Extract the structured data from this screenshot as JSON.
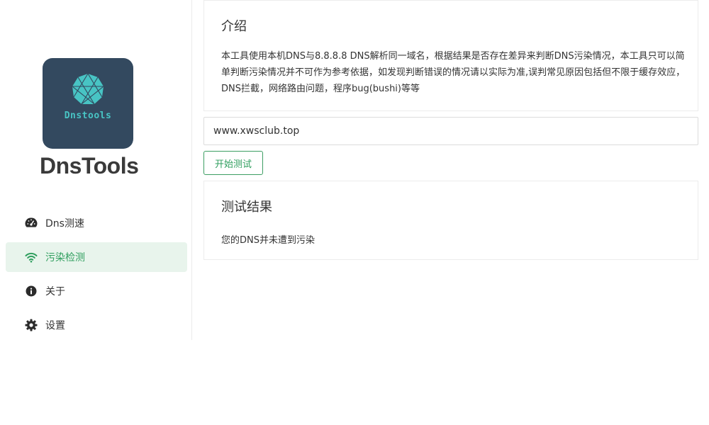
{
  "sidebar": {
    "logo_text": "Dnstools",
    "app_title": "DnsTools",
    "items": [
      {
        "label": "Dns测速",
        "icon": "speedometer-icon"
      },
      {
        "label": "污染检测",
        "icon": "wifi-icon",
        "active": true
      },
      {
        "label": "关于",
        "icon": "info-icon"
      },
      {
        "label": "设置",
        "icon": "gear-icon"
      }
    ]
  },
  "intro": {
    "title": "介绍",
    "text": "本工具使用本机DNS与8.8.8.8 DNS解析同一域名，根据结果是否存在差异来判断DNS污染情况，本工具只可以简单判断污染情况并不可作为参考依据，如发现判断错误的情况请以实际为准,误判常见原因包括但不限于缓存效应，DNS拦截，网络路由问题，程序bug(bushi)等等"
  },
  "domain_input": {
    "value": "www.xwsclub.top"
  },
  "start_button": {
    "label": "开始测试"
  },
  "result": {
    "title": "测试结果",
    "text": "您的DNS并未遭到污染"
  },
  "colors": {
    "accent": "#2f9e5e",
    "active_bg": "#e8f4ec",
    "logo_bg": "#33495f",
    "logo_teal": "#48c4c4"
  }
}
